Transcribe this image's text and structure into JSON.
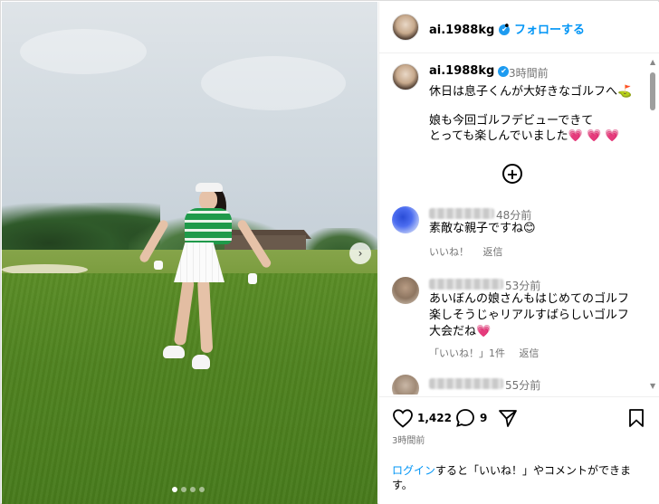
{
  "header": {
    "username": "ai.1988kg",
    "verified_icon": "✔",
    "separator": "•",
    "follow_label": "フォローする"
  },
  "caption": {
    "username": "ai.1988kg",
    "verified_icon": "✔",
    "time": "3時間前",
    "line1": "休日は息子くんが大好きなゴルフへ⛳",
    "line2": "娘も今回ゴルフデビューできて",
    "line3": "とっても楽しんでいました",
    "hearts": "💗 💗 💗",
    "more_icon": "⊕"
  },
  "comments": [
    {
      "time": "48分前",
      "text_lines": [
        "素敵な親子ですね😊"
      ],
      "like_label": "いいね！",
      "reply_label": "返信",
      "likes_label": ""
    },
    {
      "time": "53分前",
      "text_lines": [
        "あいぼんの娘さんもはじめてのゴルフ",
        "楽しそうじゃリアルすばらしいゴルフ",
        "大会だね💗"
      ],
      "like_label": "",
      "likes_label": "「いいね！」1件",
      "reply_label": "返信"
    },
    {
      "time": "55分前",
      "text_lines": [],
      "like_label": "",
      "likes_label": "",
      "reply_label": ""
    }
  ],
  "actions": {
    "likes_count": "1,422",
    "comments_count": "9",
    "post_time": "3時間前"
  },
  "login_prompt": {
    "link": "ログイン",
    "text": "すると「いいね！」やコメントができます。"
  },
  "carousel": {
    "next_icon": "›",
    "dots": 4,
    "active_dot": 0
  },
  "colors": {
    "accent": "#0095f6",
    "verified": "#1d9bf0",
    "heart": "#e8336b",
    "meta_text": "#737373"
  }
}
